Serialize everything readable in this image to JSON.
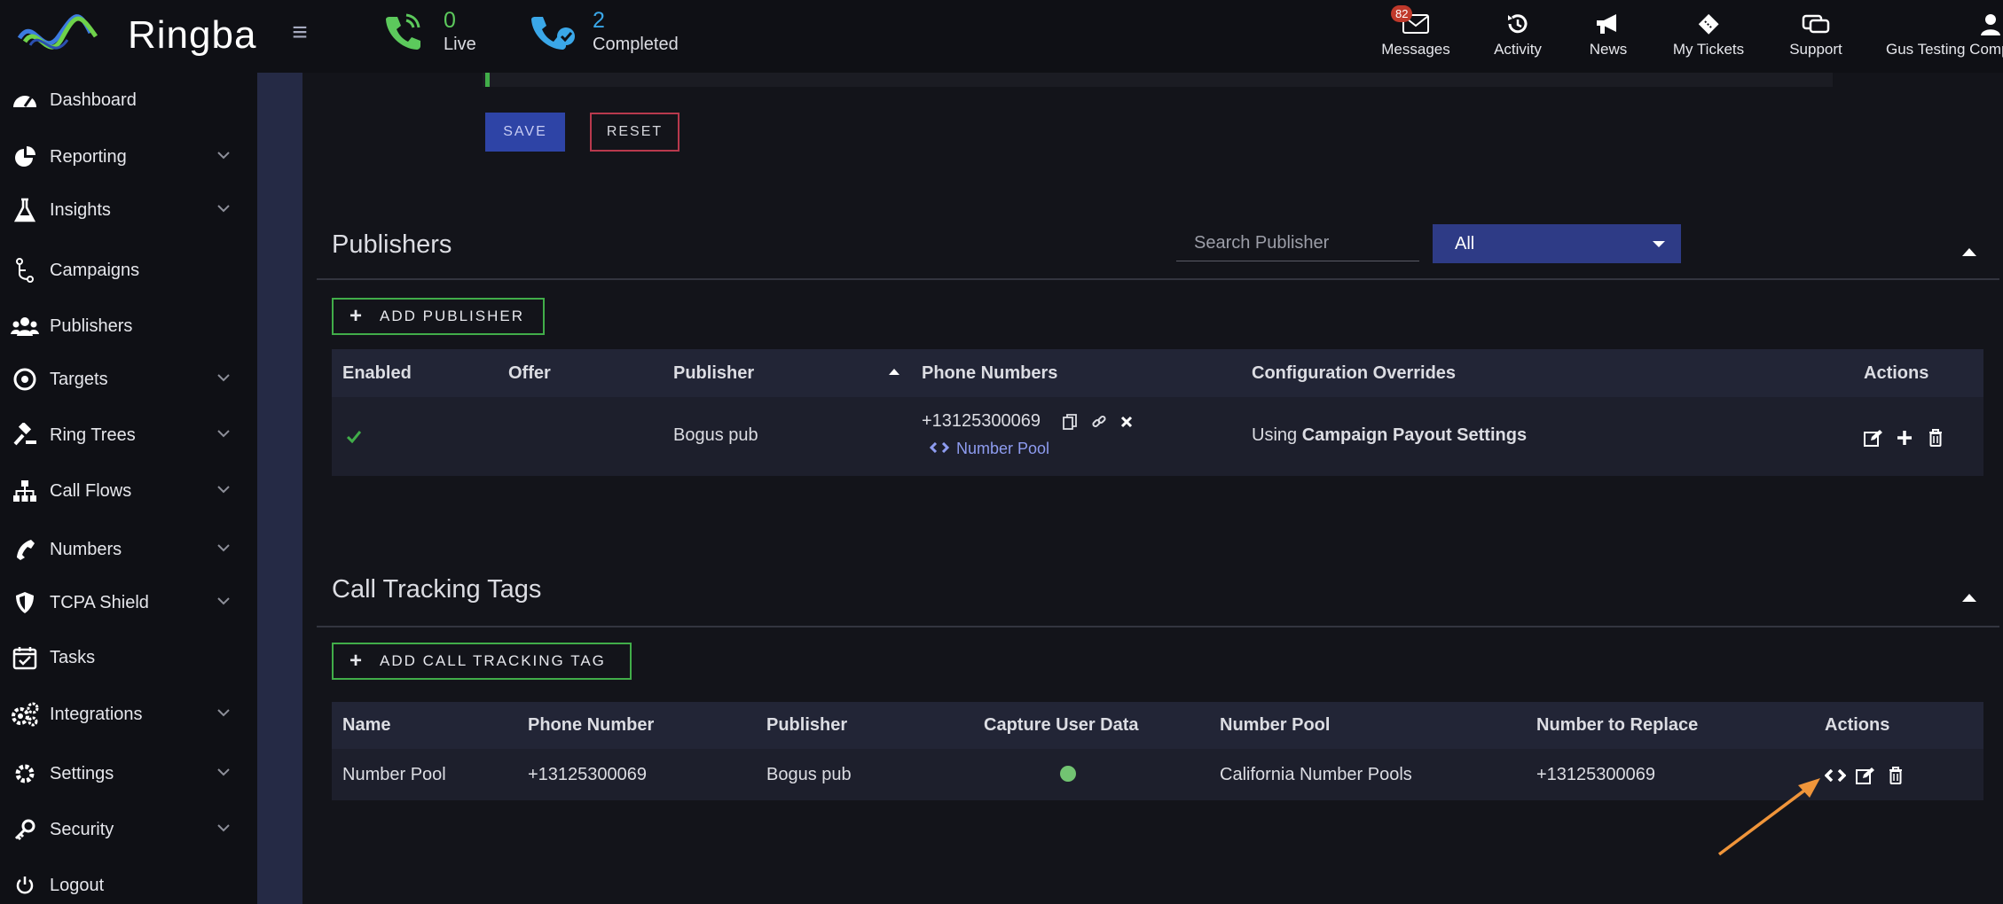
{
  "brand": {
    "name": "Ringba"
  },
  "topbar": {
    "live": {
      "count": "0",
      "label": "Live"
    },
    "completed": {
      "count": "2",
      "label": "Completed"
    },
    "nav": [
      {
        "label": "Messages",
        "badge": "82"
      },
      {
        "label": "Activity"
      },
      {
        "label": "News"
      },
      {
        "label": "My Tickets"
      },
      {
        "label": "Support"
      },
      {
        "label": "Gus Testing Comp"
      }
    ]
  },
  "sidebar": {
    "items": [
      {
        "label": "Dashboard"
      },
      {
        "label": "Reporting"
      },
      {
        "label": "Insights"
      },
      {
        "label": "Campaigns"
      },
      {
        "label": "Publishers"
      },
      {
        "label": "Targets"
      },
      {
        "label": "Ring Trees"
      },
      {
        "label": "Call Flows"
      },
      {
        "label": "Numbers"
      },
      {
        "label": "TCPA Shield"
      },
      {
        "label": "Tasks"
      },
      {
        "label": "Integrations"
      },
      {
        "label": "Settings"
      },
      {
        "label": "Security"
      },
      {
        "label": "Logout"
      }
    ]
  },
  "form": {
    "save_label": "SAVE",
    "reset_label": "RESET"
  },
  "publishers": {
    "title": "Publishers",
    "add_label": "ADD PUBLISHER",
    "search_placeholder": "Search Publisher",
    "filter_value": "All",
    "columns": [
      "Enabled",
      "Offer",
      "Publisher",
      "Phone Numbers",
      "Configuration Overrides",
      "Actions"
    ],
    "rows": [
      {
        "publisher": "Bogus pub",
        "phone": "+13125300069",
        "pool_label": "Number Pool",
        "override_prefix": "Using",
        "override_value": "Campaign Payout Settings"
      }
    ]
  },
  "call_tracking": {
    "title": "Call Tracking Tags",
    "add_label": "ADD CALL TRACKING TAG",
    "columns": [
      "Name",
      "Phone Number",
      "Publisher",
      "Capture User Data",
      "Number Pool",
      "Number to Replace",
      "Actions"
    ],
    "rows": [
      {
        "name": "Number Pool",
        "phone": "+13125300069",
        "publisher": "Bogus pub",
        "number_pool": "California Number Pools",
        "number_to_replace": "+13125300069"
      }
    ]
  },
  "colors": {
    "accent_green": "#41ad49",
    "accent_blue": "#2e3b86",
    "annotation_arrow": "#f0953a"
  }
}
